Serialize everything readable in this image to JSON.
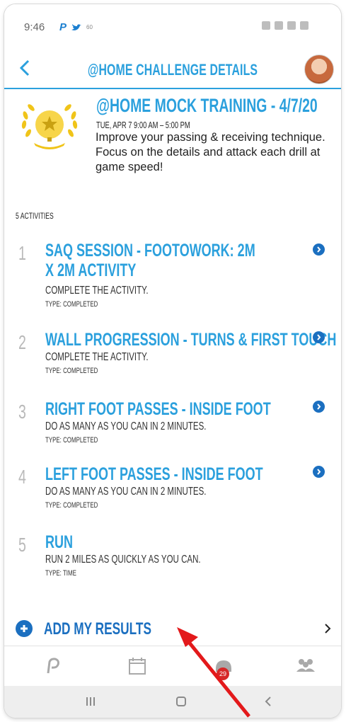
{
  "status_bar": {
    "time": "9:46",
    "app_icon_letter": "P",
    "small_text": "60"
  },
  "header": {
    "title": "@HOME CHALLENGE DETAILS"
  },
  "challenge": {
    "title": "@HOME MOCK TRAINING - 4/7/20",
    "date": "TUE, APR 7 9:00 AM – 5:00 PM",
    "description": "Improve your passing & receiving technique. Focus on the details and attack each drill at game speed!"
  },
  "activities_count": "5 ACTIVITIES",
  "activities": [
    {
      "number": "1",
      "title": "SAQ SESSION - FOOTOWORK: 2M X 2M ACTIVITY",
      "description": "COMPLETE THE ACTIVITY.",
      "type": "TYPE: COMPLETED",
      "has_link": true
    },
    {
      "number": "2",
      "title": "WALL PROGRESSION - TURNS & FIRST TOUCH",
      "description": "COMPLETE THE ACTIVITY.",
      "type": "TYPE: COMPLETED",
      "has_link": true
    },
    {
      "number": "3",
      "title": "RIGHT FOOT PASSES - INSIDE FOOT",
      "description": "DO AS MANY AS YOU CAN IN 2 MINUTES.",
      "type": "TYPE: COMPLETED",
      "has_link": true
    },
    {
      "number": "4",
      "title": "LEFT FOOT PASSES - INSIDE FOOT",
      "description": "DO AS MANY AS YOU CAN IN 2 MINUTES.",
      "type": "TYPE: COMPLETED",
      "has_link": true
    },
    {
      "number": "5",
      "title": "RUN",
      "description": "RUN 2 MILES AS QUICKLY AS YOU CAN.",
      "type": "TYPE: TIME",
      "has_link": false
    }
  ],
  "add_results": {
    "label": "ADD MY RESULTS"
  },
  "tabbar": {
    "notification_count": "29"
  },
  "colors": {
    "accent": "#2ba0dd",
    "dark_accent": "#1b6fc0",
    "badge_red": "#d62828",
    "annotation_arrow": "#e3191b"
  },
  "icons": [
    "back-arrow-icon",
    "avatar",
    "trophy-badge-icon",
    "chevron-right-circle-icon",
    "plus-circle-icon",
    "chevron-right-icon",
    "app-logo-icon",
    "calendar-icon",
    "helmet-icon",
    "team-icon"
  ]
}
